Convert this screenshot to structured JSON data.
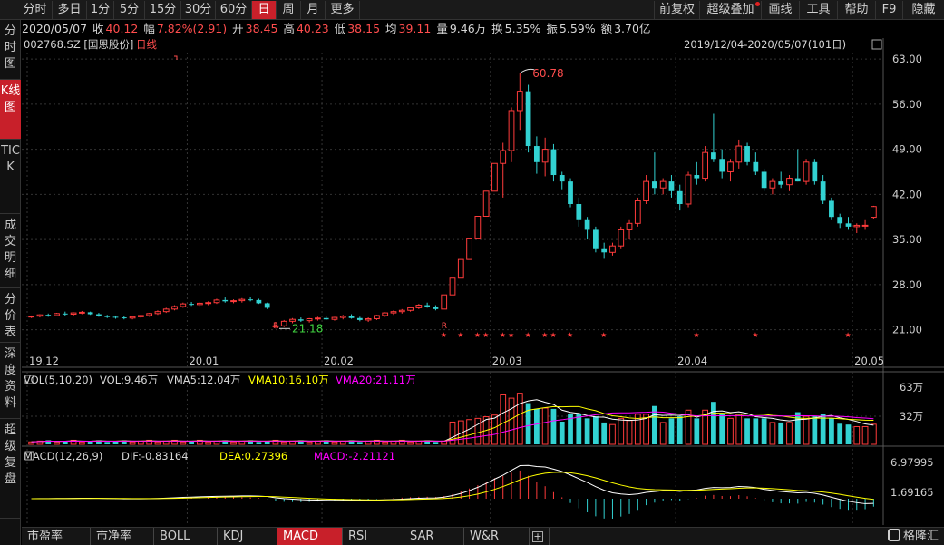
{
  "toolbar": {
    "periods": [
      "分时",
      "多日",
      "1分",
      "5分",
      "15分",
      "30分",
      "60分",
      "日",
      "周",
      "月",
      "更多"
    ],
    "active_period": "日",
    "right_items": [
      "前复权",
      "超级叠加",
      "画线",
      "工具",
      "帮助",
      "F9",
      "隐藏"
    ]
  },
  "leftnav": [
    "分时图",
    "K线图",
    "TICK",
    "成交明细",
    "分价表",
    "深度资料",
    "超级复盘"
  ],
  "leftnav_active": "K线图",
  "quote": {
    "date": "2020/05/07",
    "close_label": "收",
    "close": "40.12",
    "change_label": "幅",
    "change": "7.82%(2.91)",
    "open_label": "开",
    "open": "38.45",
    "high_label": "高",
    "high": "40.23",
    "low_label": "低",
    "low": "38.15",
    "avg_label": "均",
    "avg": "39.11",
    "vol_label": "量",
    "vol": "9.46万",
    "turnover_label": "换",
    "turnover": "5.35%",
    "amplitude_label": "振",
    "amplitude": "5.59%",
    "amount_label": "额",
    "amount": "3.70亿"
  },
  "chart_header": {
    "code": "002768.SZ [国恩股份]",
    "period": "日线",
    "range": "2019/12/04-2020/05/07(101日)"
  },
  "colors": {
    "up": "#ff3b3b",
    "down": "#32d2d2",
    "vol_ma5": "#ffffff",
    "vol_ma10": "#ffff00",
    "vol_ma20": "#ff00ff",
    "dif": "#ffffff",
    "dea": "#ffff00",
    "grid": "#333333"
  },
  "chart_data": {
    "type": "candlestick",
    "price_axis": {
      "ticks": [
        "63.00",
        "56.00",
        "49.00",
        "42.00",
        "35.00",
        "28.00",
        "21.00"
      ],
      "ylim": [
        17,
        64
      ]
    },
    "date_ticks": [
      {
        "label": "19.12",
        "index": 0
      },
      {
        "label": "20.01",
        "index": 19
      },
      {
        "label": "20.02",
        "index": 35
      },
      {
        "label": "20.03",
        "index": 55
      },
      {
        "label": "20.04",
        "index": 77
      },
      {
        "label": "20.05",
        "index": 98
      }
    ],
    "annotations": {
      "high": "60.78",
      "low": "21.18"
    },
    "candles": [
      [
        23.0,
        23.2,
        22.8,
        23.1
      ],
      [
        23.1,
        23.4,
        22.9,
        23.3
      ],
      [
        23.3,
        23.5,
        23.0,
        23.2
      ],
      [
        23.2,
        23.6,
        23.1,
        23.5
      ],
      [
        23.5,
        23.8,
        23.2,
        23.4
      ],
      [
        23.4,
        23.7,
        23.2,
        23.6
      ],
      [
        23.6,
        23.9,
        23.4,
        23.7
      ],
      [
        23.7,
        23.8,
        23.3,
        23.4
      ],
      [
        23.4,
        23.6,
        23.0,
        23.1
      ],
      [
        23.1,
        23.3,
        22.8,
        23.0
      ],
      [
        23.0,
        23.2,
        22.7,
        22.9
      ],
      [
        22.9,
        23.1,
        22.6,
        22.8
      ],
      [
        22.8,
        23.1,
        22.6,
        23.0
      ],
      [
        23.0,
        23.3,
        22.8,
        23.2
      ],
      [
        23.2,
        23.6,
        23.0,
        23.5
      ],
      [
        23.5,
        24.0,
        23.3,
        23.8
      ],
      [
        23.8,
        24.4,
        23.6,
        24.2
      ],
      [
        24.2,
        24.8,
        24.0,
        24.6
      ],
      [
        24.6,
        25.2,
        24.4,
        25.0
      ],
      [
        25.0,
        25.3,
        24.7,
        24.9
      ],
      [
        24.9,
        25.3,
        24.6,
        25.1
      ],
      [
        25.1,
        25.4,
        24.8,
        25.2
      ],
      [
        25.2,
        25.8,
        25.0,
        25.6
      ],
      [
        25.6,
        26.0,
        25.2,
        25.4
      ],
      [
        25.4,
        25.7,
        25.1,
        25.5
      ],
      [
        25.5,
        25.9,
        25.2,
        25.7
      ],
      [
        25.7,
        26.1,
        25.4,
        25.6
      ],
      [
        25.6,
        25.8,
        25.0,
        25.1
      ],
      [
        25.1,
        25.2,
        24.2,
        24.4
      ],
      [
        21.5,
        22.2,
        21.18,
        21.6
      ],
      [
        21.6,
        22.5,
        21.4,
        22.3
      ],
      [
        22.3,
        22.8,
        22.0,
        22.6
      ],
      [
        22.6,
        22.9,
        22.2,
        22.4
      ],
      [
        22.4,
        22.8,
        22.1,
        22.7
      ],
      [
        22.7,
        23.0,
        22.4,
        22.8
      ],
      [
        22.8,
        23.1,
        22.5,
        22.6
      ],
      [
        22.6,
        23.0,
        22.4,
        22.9
      ],
      [
        22.9,
        23.3,
        22.6,
        23.1
      ],
      [
        23.1,
        23.4,
        22.7,
        22.8
      ],
      [
        22.8,
        23.0,
        22.3,
        22.5
      ],
      [
        22.5,
        22.9,
        22.2,
        22.7
      ],
      [
        22.7,
        23.3,
        22.5,
        23.2
      ],
      [
        23.2,
        23.7,
        23.0,
        23.6
      ],
      [
        23.6,
        24.0,
        23.3,
        23.8
      ],
      [
        23.8,
        24.2,
        23.5,
        24.0
      ],
      [
        24.0,
        24.6,
        23.8,
        24.4
      ],
      [
        24.4,
        25.0,
        24.2,
        24.8
      ],
      [
        24.8,
        25.2,
        24.4,
        24.6
      ],
      [
        24.6,
        24.8,
        24.0,
        24.2
      ],
      [
        24.2,
        26.4,
        24.2,
        26.4
      ],
      [
        26.4,
        29.0,
        26.4,
        29.0
      ],
      [
        29.0,
        31.9,
        29.0,
        31.9
      ],
      [
        31.9,
        35.1,
        31.9,
        35.1
      ],
      [
        35.1,
        38.6,
        35.1,
        38.6
      ],
      [
        38.6,
        42.5,
        38.6,
        42.5
      ],
      [
        42.5,
        46.8,
        42.5,
        46.8
      ],
      [
        46.8,
        50.0,
        41.5,
        48.8
      ],
      [
        48.8,
        55.5,
        47.0,
        55.0
      ],
      [
        55.0,
        60.78,
        52.0,
        58.0
      ],
      [
        58.0,
        59.0,
        48.5,
        49.5
      ],
      [
        49.5,
        51.0,
        45.2,
        47.0
      ],
      [
        47.0,
        50.8,
        44.8,
        49.0
      ],
      [
        49.0,
        49.8,
        44.0,
        45.0
      ],
      [
        45.0,
        45.5,
        42.8,
        44.0
      ],
      [
        44.0,
        44.5,
        40.0,
        40.5
      ],
      [
        40.5,
        41.5,
        37.0,
        38.0
      ],
      [
        38.0,
        38.5,
        35.0,
        36.5
      ],
      [
        36.5,
        37.0,
        33.0,
        33.5
      ],
      [
        33.5,
        34.5,
        32.0,
        33.0
      ],
      [
        33.0,
        34.5,
        32.5,
        34.0
      ],
      [
        34.0,
        37.0,
        33.5,
        36.5
      ],
      [
        36.5,
        38.0,
        35.0,
        37.5
      ],
      [
        37.5,
        41.5,
        37.0,
        41.0
      ],
      [
        41.0,
        45.0,
        40.5,
        44.0
      ],
      [
        44.0,
        48.5,
        42.0,
        43.0
      ],
      [
        43.0,
        44.5,
        42.0,
        44.0
      ],
      [
        44.0,
        45.0,
        41.5,
        42.5
      ],
      [
        42.5,
        43.5,
        39.5,
        40.5
      ],
      [
        40.5,
        45.5,
        40.0,
        45.0
      ],
      [
        45.0,
        47.0,
        43.5,
        44.5
      ],
      [
        44.5,
        49.5,
        44.0,
        48.5
      ],
      [
        48.5,
        54.5,
        47.0,
        47.5
      ],
      [
        47.5,
        49.0,
        44.5,
        45.5
      ],
      [
        45.5,
        47.5,
        44.0,
        47.0
      ],
      [
        47.0,
        50.5,
        46.0,
        49.5
      ],
      [
        49.5,
        50.0,
        46.5,
        47.0
      ],
      [
        47.0,
        48.5,
        45.0,
        45.5
      ],
      [
        45.5,
        46.0,
        42.5,
        43.0
      ],
      [
        43.0,
        44.5,
        42.0,
        44.0
      ],
      [
        44.0,
        45.5,
        43.0,
        43.5
      ],
      [
        43.5,
        45.0,
        42.5,
        44.5
      ],
      [
        44.5,
        49.0,
        44.0,
        44.0
      ],
      [
        44.0,
        47.5,
        43.5,
        47.0
      ],
      [
        47.0,
        47.5,
        43.5,
        44.0
      ],
      [
        44.0,
        45.0,
        40.5,
        41.0
      ],
      [
        41.0,
        41.5,
        38.0,
        38.5
      ],
      [
        38.5,
        39.0,
        36.8,
        37.5
      ],
      [
        37.5,
        38.5,
        36.5,
        37.0
      ],
      [
        37.0,
        37.5,
        36.0,
        37.2
      ],
      [
        37.2,
        38.0,
        36.5,
        37.21
      ],
      [
        38.45,
        40.23,
        38.15,
        40.12
      ]
    ],
    "limit_up_marks": [
      {
        "index": 29,
        "mark": "R"
      },
      {
        "index": 49,
        "mark": "R"
      }
    ],
    "star_indices": [
      49,
      51,
      53,
      54,
      56,
      57,
      59,
      61,
      62,
      64,
      68,
      79,
      86,
      97
    ],
    "vol": {
      "label": "VOL(5,10,20)",
      "vol_label": "VOL:9.46万",
      "ma5_label": "VMA5:12.04万",
      "ma10_label": "VMA10:16.10万",
      "ma20_label": "VMA20:21.11万",
      "axis": [
        "63万",
        "32万"
      ],
      "ymax": 66
    },
    "macd": {
      "label": "MACD(12,26,9)",
      "dif_label": "DIF:-0.83164",
      "dea_label": "DEA:0.27396",
      "macd_label": "MACD:-2.21121",
      "axis": [
        "6.97995",
        "1.69165"
      ]
    }
  },
  "tabs": [
    "市盈率",
    "市净率",
    "BOLL",
    "KDJ",
    "MACD",
    "RSI",
    "SAR",
    "W&R"
  ],
  "tabs_active": "MACD",
  "logo": "格隆汇"
}
